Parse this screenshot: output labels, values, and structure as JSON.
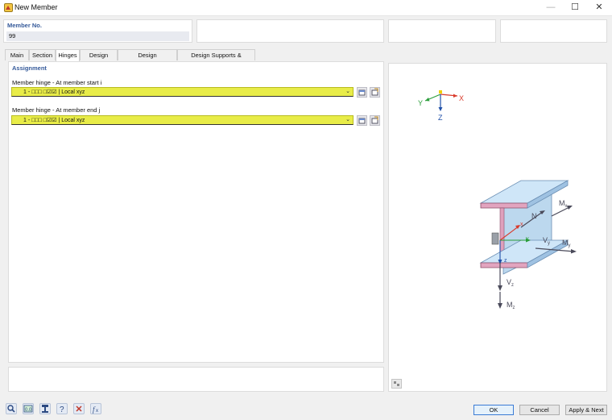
{
  "window": {
    "title": "New Member",
    "min": "—",
    "max": "☐",
    "close": "✕"
  },
  "member": {
    "label": "Member No.",
    "value": "99"
  },
  "tabs": [
    {
      "label": "Main"
    },
    {
      "label": "Section"
    },
    {
      "label": "Hinges"
    },
    {
      "label": "Design Types"
    },
    {
      "label": "Design Configurations"
    },
    {
      "label": "Design Supports & Deflection"
    }
  ],
  "assignment": {
    "title": "Assignment",
    "start_label": "Member hinge - At member start i",
    "start_value": "1 - □□□  □☑☑ | Local xyz",
    "end_label": "Member hinge - At member end j",
    "end_value": "1 - □□□  □☑☑ | Local xyz"
  },
  "preview": {
    "axes": {
      "x": "X",
      "y": "Y",
      "z": "Z"
    },
    "beam_labels": {
      "mx": "M",
      "mx_sub": "x",
      "n": "N",
      "vy": "V",
      "vy_sub": "y",
      "my": "M",
      "my_sub": "y",
      "x": "x",
      "y": "y",
      "z": "z",
      "vz": "V",
      "vz_sub": "z",
      "mz": "M",
      "mz_sub": "z"
    }
  },
  "buttons": {
    "ok": "OK",
    "cancel": "Cancel",
    "apply_next": "Apply & Next"
  },
  "colors": {
    "accent": "#355a9a",
    "combo": "#e8ec48",
    "axis_x": "#d93a2b",
    "axis_y": "#2a9d3a",
    "axis_z": "#1f4fa8"
  }
}
